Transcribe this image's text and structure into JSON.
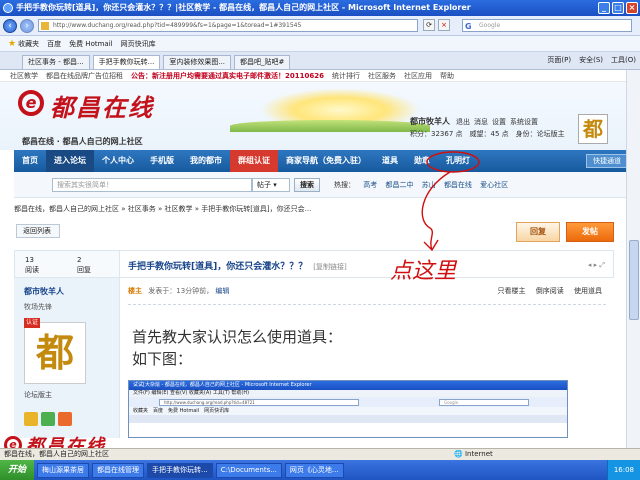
{
  "window": {
    "title": "手把手教你玩转[道具]，你还只会灌水？？？|社区教学 - 都昌在线，都昌人自己的网上社区 - Microsoft Internet Explorer"
  },
  "address_bar": {
    "url": "http://www.duchang.org/read.php?tid=489999&fs=1&page=1&toread=1#391545",
    "search_placeholder": "Google"
  },
  "favorites_bar": {
    "favorites_label": "收藏夹",
    "items": [
      "百度",
      "免费 Hotmail",
      "网页快讯库"
    ]
  },
  "tabs": [
    {
      "label": "社区事务 - 都昌..."
    },
    {
      "label": "手把手教你玩转..."
    },
    {
      "label": "室内装修效果图..."
    },
    {
      "label": "都昌吧_贴吧#"
    }
  ],
  "command_bar": [
    "页面(P)",
    "安全(S)",
    "工具(O)"
  ],
  "top_strip": {
    "links": [
      "社区教学",
      "都昌在线品牌广告位招租"
    ],
    "notice": "公告：新注册用户均需要通过真实电子邮件激活！20110626",
    "right_links": [
      "统计排行",
      "社区服务",
      "社区应用",
      "帮助"
    ]
  },
  "header": {
    "logo_mark": "e",
    "logo_text": "都昌在线",
    "slogan": "都昌在线 · 都昌人自己的网上社区",
    "user": {
      "name": "都市牧羊人",
      "links": [
        "退出",
        "消息",
        "设置",
        "系统设置"
      ],
      "points_line": "积分：32367 点　威望：45 点　身份：论坛版主",
      "avatar_char": "都"
    }
  },
  "main_nav": {
    "items": [
      "首页",
      "进入论坛",
      "个人中心",
      "手机版",
      "我的都市",
      "群组认证",
      "商家导航（免费入驻）",
      "道具",
      "勋章",
      "孔明灯"
    ],
    "quick": "快捷通道"
  },
  "search": {
    "placeholder": "搜索其实很简单！",
    "select": "帖子",
    "button": "搜索",
    "hot_label": "热搜：",
    "hot_items": [
      "高考",
      "都昌二中",
      "苏山",
      "都昌在线",
      "爱心社区"
    ]
  },
  "breadcrumb": "都昌在线，都昌人自己的网上社区 » 社区事务 » 社区教学 » 手把手教你玩转[道具]，你还只会...",
  "back_button": "返回列表",
  "reply_button": "回复",
  "post_button": "发帖",
  "thread": {
    "views": "13",
    "views_label": "阅读",
    "replies": "2",
    "replies_label": "回复",
    "title": "手把手教你玩转[道具]，你还只会灌水？？？",
    "copy_link": "[复制链接]"
  },
  "author_panel": {
    "name": "都市牧羊人",
    "rank": "牧场先锋",
    "badge": "认证",
    "avatar_char": "都",
    "role": "论坛版主"
  },
  "post": {
    "owner_tag": "楼主",
    "posted": "发表于：13分钟前，",
    "edit": "编辑",
    "options": [
      "只看楼主",
      "倒序阅读",
      "使用道具"
    ],
    "lines": [
      "首先教大家认识怎么使用道具：",
      "如下图："
    ]
  },
  "annotation": "点这里",
  "embedded_screenshot": {
    "title": "试试[大杂烩 - 都昌在线，都昌人自己的网上社区 - Microsoft Internet Explorer",
    "url": "http://www.duchang.org/read.php?tid=48721",
    "search": "Google",
    "fav": "收藏夹　百度　免费 Hotmail　网页快讯库"
  },
  "watermark_text": "都昌在线",
  "statusbar": {
    "left": "都昌在线，都昌人自己的网上社区",
    "zone": "Internet"
  },
  "taskbar": {
    "start": "开始",
    "items": [
      "梅山源果茶居",
      "都昌在线管理",
      "手把手教你玩转...",
      "C:\\Documents...",
      "网页《心灵地..."
    ],
    "clock": "16:08"
  },
  "colors": {
    "brand_red": "#c4121b",
    "nav_blue": "#1f64a8",
    "annotation_red": "#d01010"
  }
}
